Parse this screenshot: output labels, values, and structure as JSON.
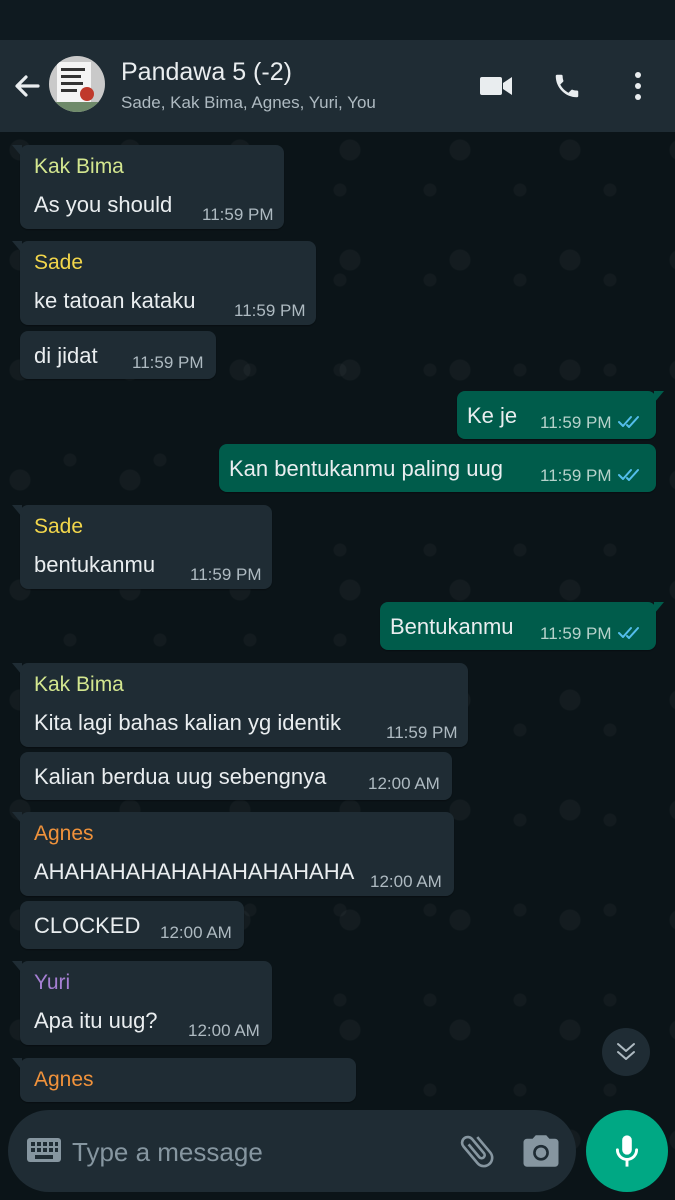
{
  "header": {
    "title": "Pandawa 5 (-2)",
    "subtitle": "Sade, Kak Bima, Agnes, Yuri, You",
    "avatar_text": "10 YANG SALAH/ 10 YANG SALAH"
  },
  "colors": {
    "kak_bima": "#d3e68f",
    "sade": "#f2d64b",
    "agnes": "#f0923b",
    "yuri": "#a57fd3",
    "accent": "#00a884",
    "read_ticks": "#53bdeb"
  },
  "messages": [
    {
      "sender": "Kak Bima",
      "text": "As you should",
      "time": "11:59 PM"
    },
    {
      "sender": "Sade",
      "text": "ke tatoan kataku",
      "time": "11:59 PM"
    },
    {
      "text": "di jidat",
      "time": "11:59 PM"
    },
    {
      "text": "Ke je",
      "time": "11:59 PM",
      "status": "read"
    },
    {
      "text": "Kan bentukanmu paling uug",
      "time": "11:59 PM",
      "status": "read"
    },
    {
      "sender": "Sade",
      "text": "bentukanmu",
      "time": "11:59 PM"
    },
    {
      "text": "Bentukanmu",
      "time": "11:59 PM",
      "status": "read"
    },
    {
      "sender": "Kak Bima",
      "text": "Kita lagi bahas kalian yg identik",
      "time": "11:59 PM"
    },
    {
      "text": "Kalian berdua uug sebengnya",
      "time": "12:00 AM"
    },
    {
      "sender": "Agnes",
      "text": "AHAHAHAHAHAHAHAHAHAHA",
      "time": "12:00 AM"
    },
    {
      "text": "CLOCKED",
      "time": "12:00 AM"
    },
    {
      "sender": "Yuri",
      "text": "Apa itu uug?",
      "time": "12:00 AM"
    },
    {
      "sender": "Agnes"
    }
  ],
  "compose": {
    "placeholder": "Type a message"
  },
  "icons": {
    "back": "back-arrow-icon",
    "video": "video-camera-icon",
    "call": "phone-icon",
    "menu": "more-vertical-icon",
    "scroll": "chevron-double-down-icon",
    "keyboard": "keyboard-icon",
    "attach": "paperclip-icon",
    "camera": "camera-icon",
    "mic": "microphone-icon"
  }
}
